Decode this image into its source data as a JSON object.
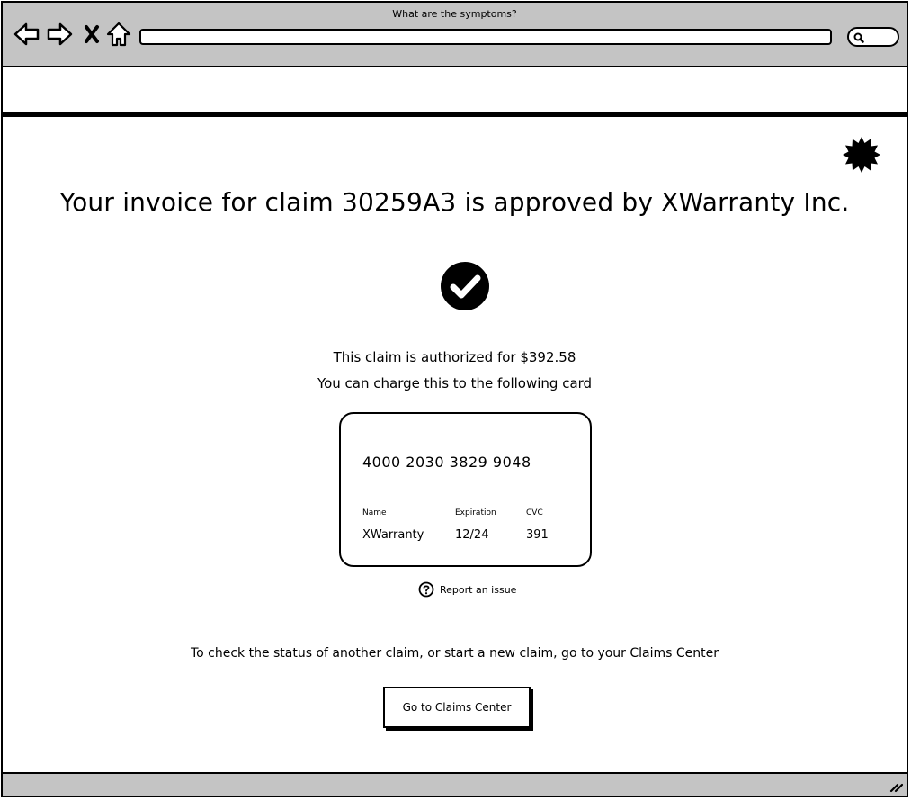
{
  "window": {
    "title": "What are the symptoms?"
  },
  "browser": {
    "url": "",
    "icons": [
      "back-arrow-icon",
      "forward-arrow-icon",
      "stop-icon",
      "home-icon",
      "search-icon"
    ]
  },
  "page": {
    "headline": "Your invoice for claim 30259A3 is approved by XWarranty Inc.",
    "authorized_text": "This claim is authorized for $392.58",
    "charge_text": "You can charge this to the following card",
    "card": {
      "number": "4000 2030 3829 9048",
      "name_label": "Name",
      "name_value": "XWarranty",
      "expiration_label": "Expiration",
      "expiration_value": "12/24",
      "cvc_label": "CVC",
      "cvc_value": "391"
    },
    "report_link": "Report an issue",
    "status_text": "To check the status of another claim, or start a new claim, go to your Claims Center",
    "cta_button": "Go to Claims Center"
  },
  "colors": {
    "chrome": "#c4c4c4",
    "ink": "#000000",
    "background": "#ffffff"
  }
}
